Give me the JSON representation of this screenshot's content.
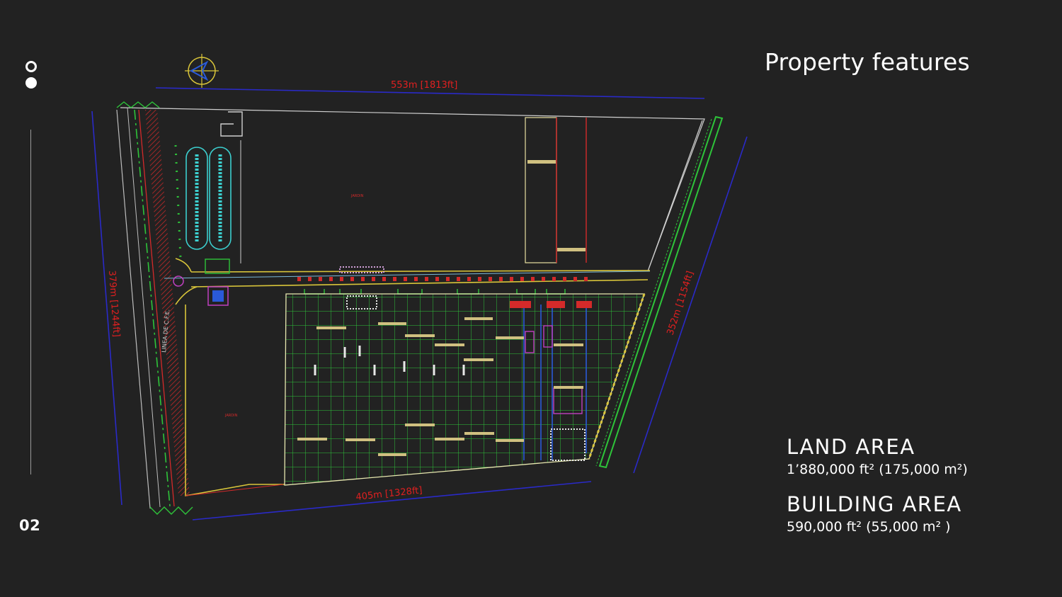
{
  "page": {
    "number": "02",
    "title": "Property features"
  },
  "stats": [
    {
      "label": "LAND AREA",
      "value": "1’880,000 ft² (175,000 m²)"
    },
    {
      "label": "BUILDING AREA",
      "value": "590,000 ft² (55,000 m² )"
    }
  ],
  "plan": {
    "dim_top": "553m  [1813ft]",
    "dim_left": "379m  [1244ft]",
    "dim_right": "352m  [1154ft]",
    "dim_bottom": "405m  [1328ft]",
    "road_label": "LINEA DE C.F.E."
  },
  "colors": {
    "background": "#222222",
    "text": "#ffffff",
    "dimension": "#e02020",
    "boundary": "#2a2ac8",
    "grid": "#22c22e"
  }
}
